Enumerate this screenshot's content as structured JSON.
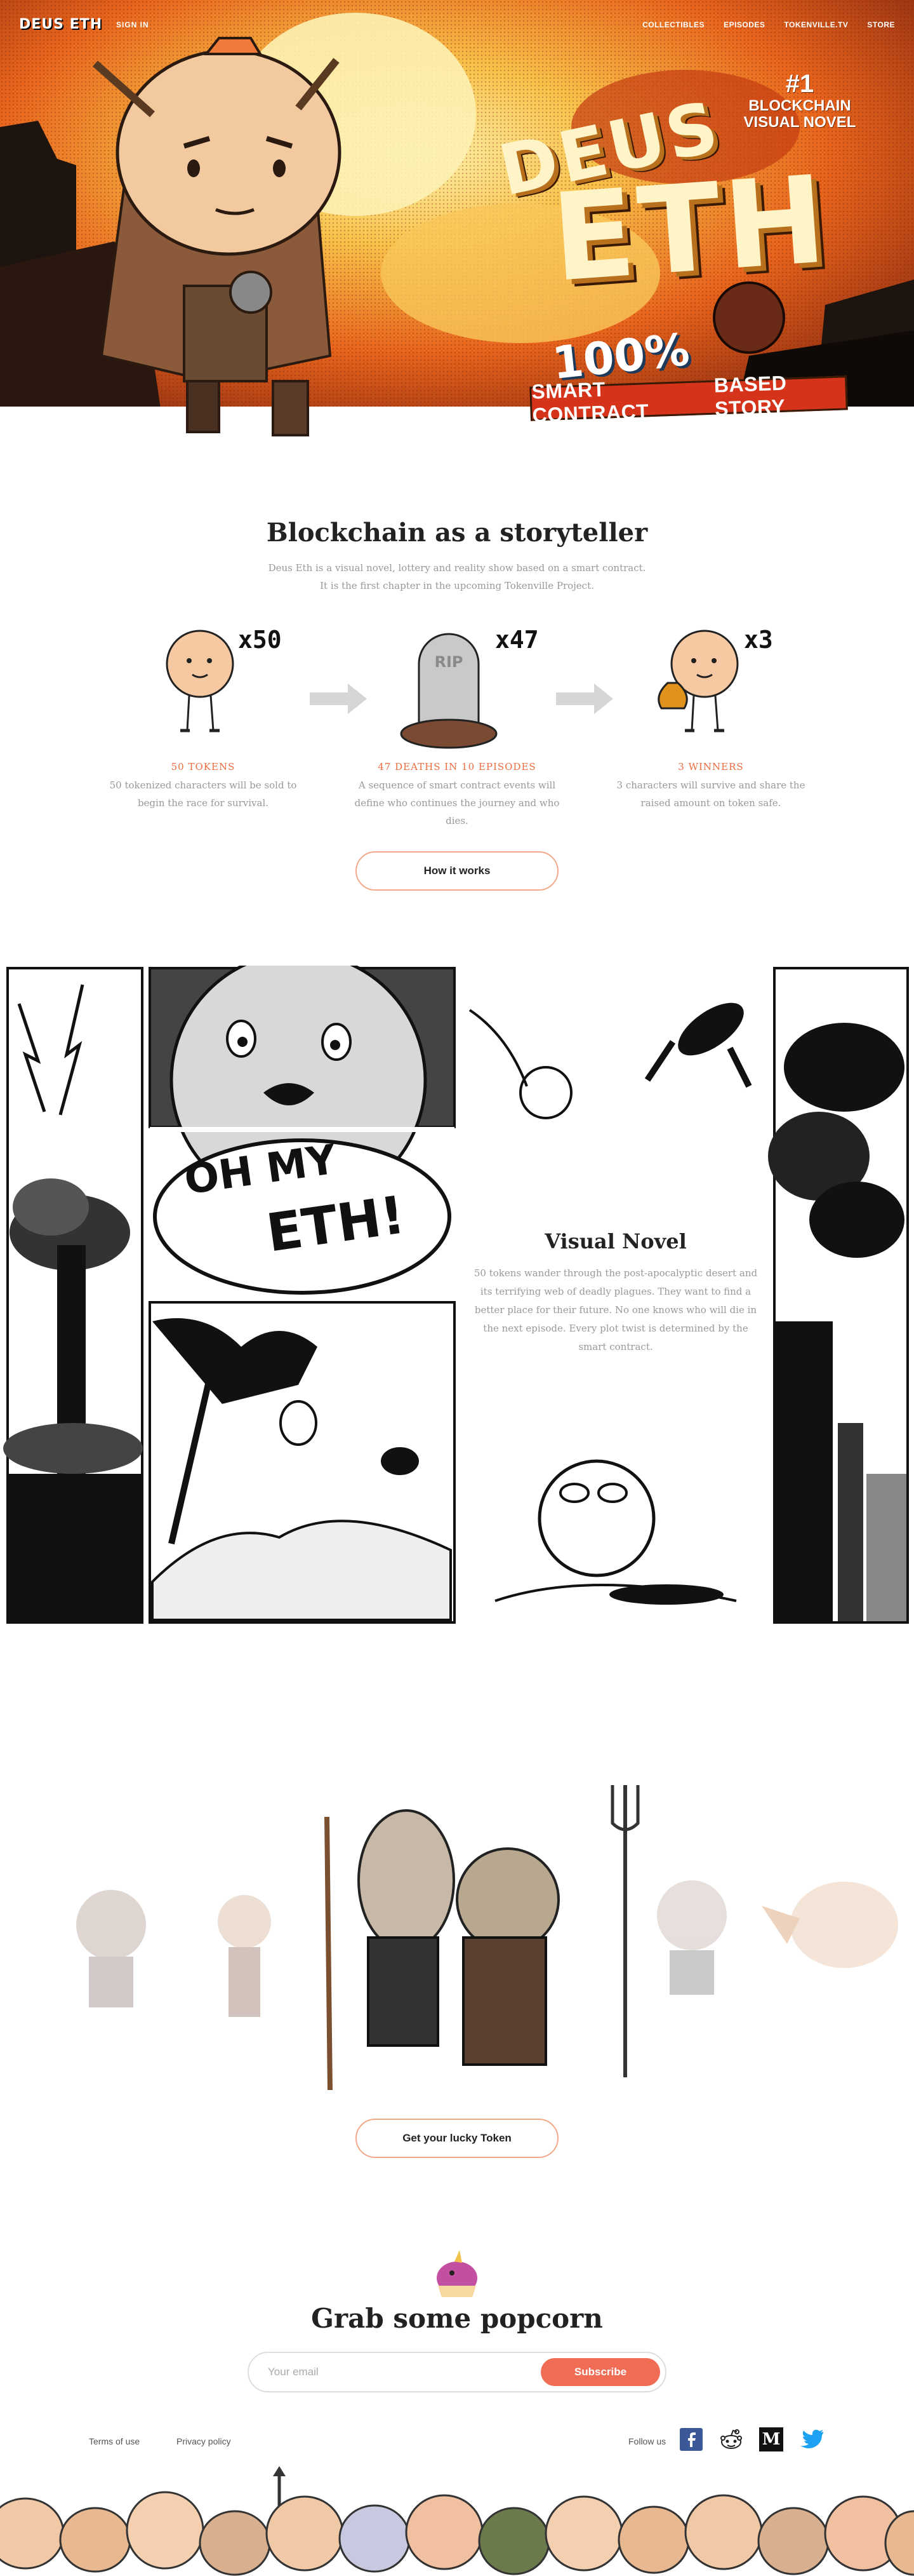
{
  "header": {
    "logo": "DEUS ETH",
    "sign_in": "SIGN IN",
    "nav": [
      "COLLECTIBLES",
      "EPISODES",
      "TOKENVILLE.TV",
      "STORE"
    ]
  },
  "hero": {
    "rank": "#1",
    "rank_line1": "BLOCKCHAIN",
    "rank_line2": "VISUAL NOVEL",
    "title_word1": "DEUS",
    "title_word2": "ETH",
    "percent": "100%",
    "ribbon_left": "SMART CONTRACT",
    "ribbon_right": "BASED STORY"
  },
  "storyteller": {
    "title": "Blockchain as a storyteller",
    "subtitle": "Deus Eth is a visual novel, lottery and reality show based on a smart contract. It is the first chapter in the upcoming Tokenville Project.",
    "steps": [
      {
        "multiplier": "x50",
        "label": "50 TOKENS",
        "desc": "50 tokenized characters will be sold to begin the race for survival."
      },
      {
        "multiplier": "x47",
        "label": "47 DEATHS IN 10 EPISODES",
        "desc": "A sequence of smart contract events will define who continues the journey and who dies."
      },
      {
        "multiplier": "x3",
        "label": "3 WINNERS",
        "desc": "3 characters will survive and share the raised amount on token safe."
      }
    ],
    "tombstone_text": "RIP",
    "button": "How it works"
  },
  "visual_novel": {
    "title": "Visual Novel",
    "desc": "50 tokens wander through the post-apocalyptic desert and its terrifying web of deadly plagues. They want to find a better place for their future. No one knows who will die in the next episode. Every plot twist is determined by the smart contract.",
    "speech_line1": "OH MY",
    "speech_line2": "ETH!"
  },
  "characters": {
    "button": "Get your lucky Token"
  },
  "popcorn": {
    "title": "Grab some popcorn",
    "email_placeholder": "Your email",
    "subscribe": "Subscribe"
  },
  "footer": {
    "terms": "Terms of use",
    "privacy": "Privacy policy",
    "follow": "Follow us",
    "social": [
      "facebook-icon",
      "reddit-icon",
      "medium-icon",
      "twitter-icon"
    ],
    "medium_glyph": "M"
  },
  "colors": {
    "accent": "#f06c3e",
    "button_border": "#f4a88a",
    "subscribe": "#f06c55",
    "facebook": "#3b5998",
    "twitter": "#1da1f2"
  }
}
